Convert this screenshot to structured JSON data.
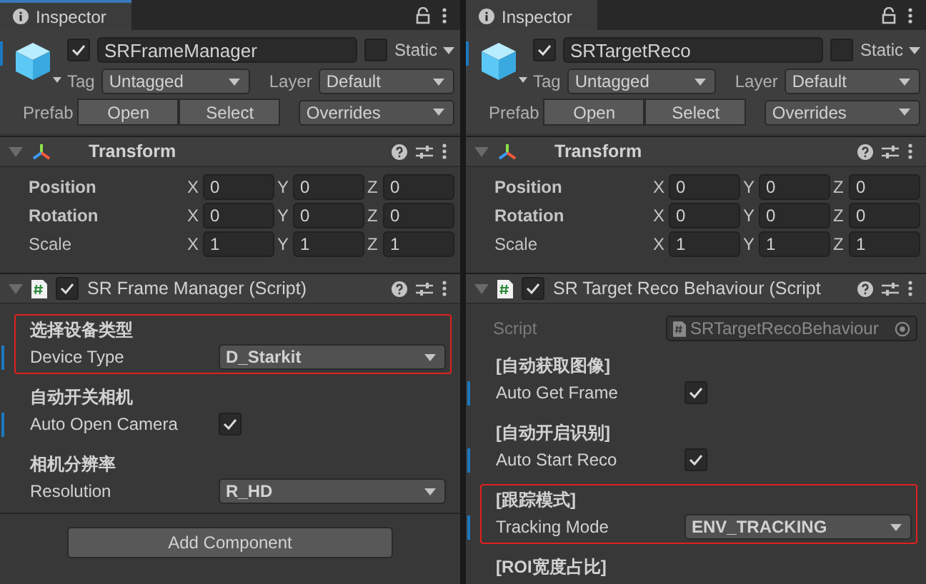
{
  "panels": [
    {
      "tab": {
        "title": "Inspector",
        "focused": true
      },
      "object": {
        "active": true,
        "name": "SRFrameManager",
        "static": false,
        "static_label": "Static",
        "tag_label": "Tag",
        "tag": "Untagged",
        "layer_label": "Layer",
        "layer": "Default",
        "prefab_label": "Prefab",
        "prefab_buttons": [
          "Open",
          "Select"
        ],
        "overrides": "Overrides"
      },
      "transform": {
        "title": "Transform",
        "rows": [
          {
            "label": "Position",
            "overridden": true,
            "fields": [
              {
                "axis": "X",
                "value": "0"
              },
              {
                "axis": "Y",
                "value": "0"
              },
              {
                "axis": "Z",
                "value": "0"
              }
            ]
          },
          {
            "label": "Rotation",
            "overridden": true,
            "fields": [
              {
                "axis": "X",
                "value": "0"
              },
              {
                "axis": "Y",
                "value": "0"
              },
              {
                "axis": "Z",
                "value": "0"
              }
            ]
          },
          {
            "label": "Scale",
            "overridden": false,
            "fields": [
              {
                "axis": "X",
                "value": "1"
              },
              {
                "axis": "Y",
                "value": "1"
              },
              {
                "axis": "Z",
                "value": "1"
              }
            ]
          }
        ]
      },
      "script": {
        "title": "SR Frame Manager (Script)",
        "enabled": true,
        "properties": [
          {
            "header": "选择设备类型",
            "label": "Device Type",
            "kind": "dropdown",
            "value": "D_Starkit",
            "overridden": true,
            "highlighted": true
          },
          {
            "header": "自动开关相机",
            "label": "Auto Open Camera",
            "kind": "checkbox",
            "checked": true,
            "overridden": true,
            "highlighted": false
          },
          {
            "header": "相机分辨率",
            "label": "Resolution",
            "kind": "dropdown",
            "value": "R_HD",
            "overridden": false,
            "highlighted": false
          }
        ]
      },
      "add_component": "Add Component"
    },
    {
      "tab": {
        "title": "Inspector",
        "focused": false
      },
      "object": {
        "active": true,
        "name": "SRTargetReco",
        "static": false,
        "static_label": "Static",
        "tag_label": "Tag",
        "tag": "Untagged",
        "layer_label": "Layer",
        "layer": "Default",
        "prefab_label": "Prefab",
        "prefab_buttons": [
          "Open",
          "Select"
        ],
        "overrides": "Overrides"
      },
      "transform": {
        "title": "Transform",
        "rows": [
          {
            "label": "Position",
            "overridden": true,
            "fields": [
              {
                "axis": "X",
                "value": "0"
              },
              {
                "axis": "Y",
                "value": "0"
              },
              {
                "axis": "Z",
                "value": "0"
              }
            ]
          },
          {
            "label": "Rotation",
            "overridden": true,
            "fields": [
              {
                "axis": "X",
                "value": "0"
              },
              {
                "axis": "Y",
                "value": "0"
              },
              {
                "axis": "Z",
                "value": "0"
              }
            ]
          },
          {
            "label": "Scale",
            "overridden": false,
            "fields": [
              {
                "axis": "X",
                "value": "1"
              },
              {
                "axis": "Y",
                "value": "1"
              },
              {
                "axis": "Z",
                "value": "1"
              }
            ]
          }
        ]
      },
      "script": {
        "title": "SR Target Reco Behaviour (Script",
        "enabled": true,
        "script_field": {
          "label": "Script",
          "value": "SRTargetRecoBehaviour"
        },
        "properties": [
          {
            "header": "[自动获取图像]",
            "label": "Auto Get Frame",
            "kind": "checkbox",
            "checked": true,
            "overridden": true,
            "highlighted": false
          },
          {
            "header": "[自动开启识别]",
            "label": "Auto Start Reco",
            "kind": "checkbox",
            "checked": true,
            "overridden": true,
            "highlighted": false
          },
          {
            "header": "[跟踪模式]",
            "label": "Tracking Mode",
            "kind": "dropdown",
            "value": "ENV_TRACKING",
            "overridden": true,
            "highlighted": true
          },
          {
            "header": "[ROI宽度占比]",
            "kind": "header_only",
            "highlighted": false
          }
        ]
      }
    }
  ]
}
